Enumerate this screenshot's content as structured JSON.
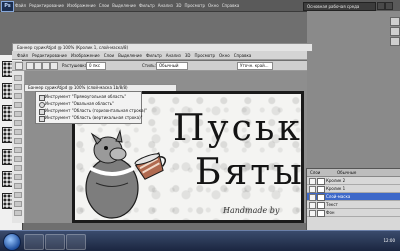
{
  "app": {
    "logo": "Ps",
    "menu": [
      "Файл",
      "Редактирование",
      "Изображение",
      "Слои",
      "Выделение",
      "Фильтр",
      "Анализ",
      "3D",
      "Просмотр",
      "Окно",
      "Справка"
    ],
    "workspace_button": "Основная рабочая среда"
  },
  "window": {
    "title": "Баннер сурикАtjpd @ 100% (Кролик 1, слой-маска/8)"
  },
  "menubar": [
    "Файл",
    "Редактирование",
    "Изображение",
    "Слои",
    "Выделение",
    "Фильтр",
    "Анализ",
    "3D",
    "Просмотр",
    "Окно",
    "Справка"
  ],
  "options": {
    "style_label": "Стиль:",
    "style_value": "Обычный",
    "feather_label": "Растушевка:",
    "feather_value": "0 пкс",
    "refine_button": "Уточн. край..."
  },
  "document": {
    "tab_title": "Баннер сурикАtjpd @ 100% (слой-маска 1b/8/8)",
    "title_line1": "Пуськи",
    "title_line2": "Бятые",
    "credit": "Handmade by"
  },
  "preset_list": {
    "items": [
      "Инструмент \"Прямоугольная область\"",
      "Инструмент \"Овальная область\"",
      "Инструмент \"Область (горизонтальная строка)\"",
      "Инструмент \"Область (вертикальная строка)\""
    ]
  },
  "layers": {
    "panel_title": "Слои",
    "blend_mode": "Обычные",
    "rows": [
      {
        "name": "Кролик 2"
      },
      {
        "name": "Кролик 1"
      },
      {
        "name": "Слой-маска",
        "selected": true
      },
      {
        "name": "Текст"
      },
      {
        "name": "Фон"
      }
    ]
  },
  "taskbar": {
    "clock": "12:00"
  }
}
